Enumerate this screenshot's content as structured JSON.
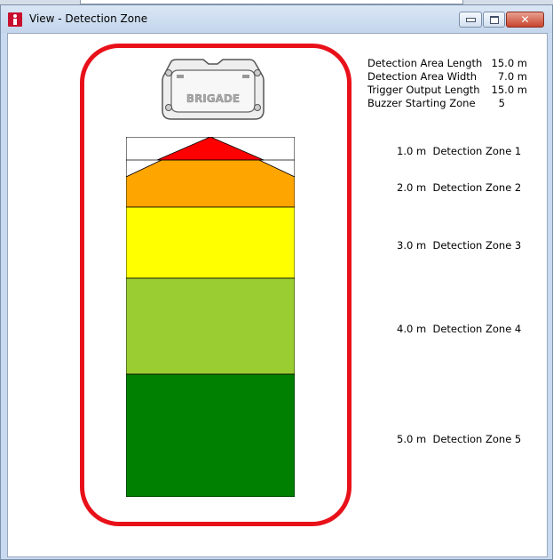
{
  "window": {
    "title": "View - Detection Zone"
  },
  "sensor": {
    "brand": "BRIGADE"
  },
  "info": [
    {
      "label": "Detection Area Length",
      "value": "15.0 m"
    },
    {
      "label": "Detection Area Width",
      "value": "7.0 m"
    },
    {
      "label": "Trigger Output Length",
      "value": "15.0 m"
    },
    {
      "label": "Buzzer Starting Zone",
      "value": "5"
    }
  ],
  "zones": [
    {
      "distance": "1.0 m",
      "name": "Detection Zone 1",
      "color": "#ff0000"
    },
    {
      "distance": "2.0 m",
      "name": "Detection Zone 2",
      "color": "#ffa500"
    },
    {
      "distance": "3.0 m",
      "name": "Detection Zone 3",
      "color": "#ffff00"
    },
    {
      "distance": "4.0 m",
      "name": "Detection Zone 4",
      "color": "#9acd32"
    },
    {
      "distance": "5.0 m",
      "name": "Detection Zone 5",
      "color": "#008000"
    }
  ],
  "colors": {
    "highlight_ring": "#e8111a",
    "title_bar": "#c9daf0"
  }
}
